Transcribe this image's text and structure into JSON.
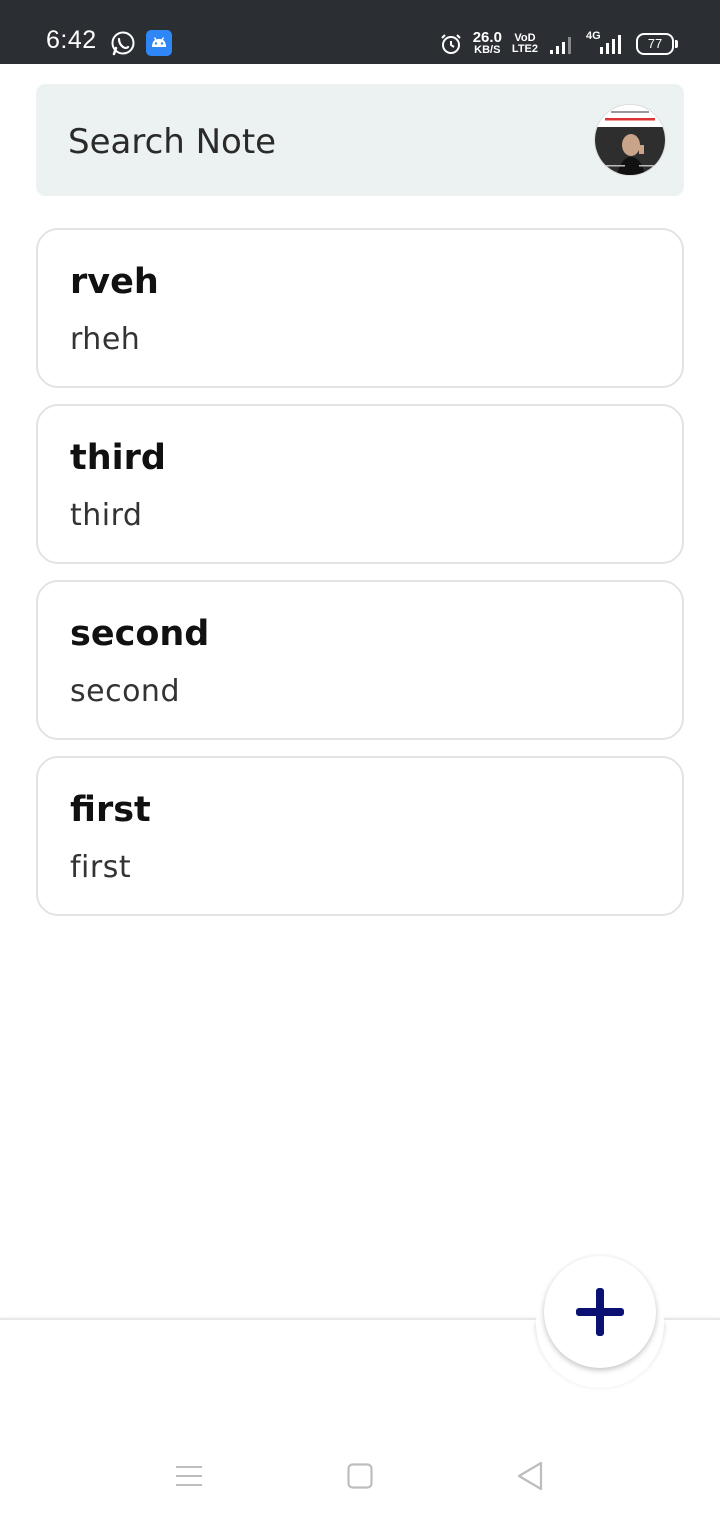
{
  "status_bar": {
    "time": "6:42",
    "net_speed_value": "26.0",
    "net_speed_unit": "KB/S",
    "volte_top": "VoD",
    "volte_bottom": "LTE2",
    "network": "4G",
    "battery": "77",
    "icons": [
      "whatsapp-icon",
      "android-icon",
      "alarm-icon",
      "signal-icon",
      "4g-signal-icon",
      "battery-icon"
    ]
  },
  "search": {
    "label": "Search Note",
    "avatar_icon": "profile-avatar"
  },
  "notes": [
    {
      "title": "rveh",
      "body": "rheh"
    },
    {
      "title": "third",
      "body": "third"
    },
    {
      "title": "second",
      "body": "second"
    },
    {
      "title": "first",
      "body": "first"
    }
  ],
  "fab": {
    "icon": "plus-icon",
    "color": "#0b1073"
  },
  "nav": {
    "icons": [
      "menu-icon",
      "home-icon",
      "back-icon"
    ]
  },
  "colors": {
    "search_bg": "#ecf1f1",
    "status_bg": "#2b2f33",
    "card_border": "#e3e3e3"
  }
}
